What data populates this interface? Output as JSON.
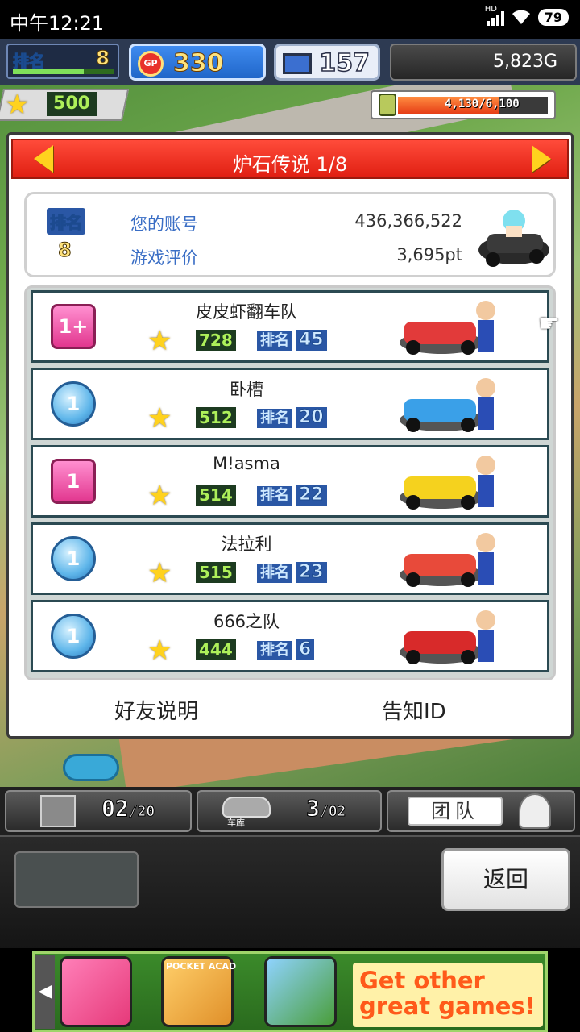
{
  "status_bar": {
    "time": "中午12:21",
    "battery": "79",
    "network": "HD"
  },
  "hud": {
    "rank_label": "排名",
    "rank_value": "8",
    "rank_progress": 0.7,
    "gp_icon_text": "GP",
    "gp_value": "330",
    "pc_value": "157",
    "money": "5,823G",
    "stars": "500",
    "funds_text": "4,130/6,100",
    "funds_fraction": 0.68
  },
  "panel": {
    "title": "炉石传说 1/8",
    "account": {
      "rank_label": "排名",
      "rank_value": "8",
      "account_label": "您的账号",
      "account_value": "436,366,522",
      "rating_label": "游戏评价",
      "rating_value": "3,695pt"
    },
    "rows": [
      {
        "badge": "1+",
        "badge_style": "pink",
        "name": "皮皮虾翻车队",
        "score": "728",
        "rank_label": "排名",
        "rank": "45"
      },
      {
        "badge": "1",
        "badge_style": "blue",
        "name": "卧槽",
        "score": "512",
        "rank_label": "排名",
        "rank": "20"
      },
      {
        "badge": "1",
        "badge_style": "pink",
        "name": "M!asma",
        "score": "514",
        "rank_label": "排名",
        "rank": "22"
      },
      {
        "badge": "1",
        "badge_style": "blue",
        "name": "法拉利",
        "score": "515",
        "rank_label": "排名",
        "rank": "23"
      },
      {
        "badge": "1",
        "badge_style": "blue",
        "name": "666之队",
        "score": "444",
        "rank_label": "排名",
        "rank": "6"
      }
    ],
    "friend_help": "好友说明",
    "notify_id": "告知ID"
  },
  "bottom": {
    "parts_count": "02",
    "parts_total": "20",
    "garage_label": "车库",
    "garage_count": "3",
    "garage_total": "02",
    "team_label": "团队",
    "back_label": "返回"
  },
  "ad": {
    "app2_title": "POCKET ACAD",
    "text": "Get other great games!"
  },
  "colors": {
    "title_red": "#e01f12",
    "link_blue": "#3a6ec5",
    "score_green": "#aef05a"
  }
}
